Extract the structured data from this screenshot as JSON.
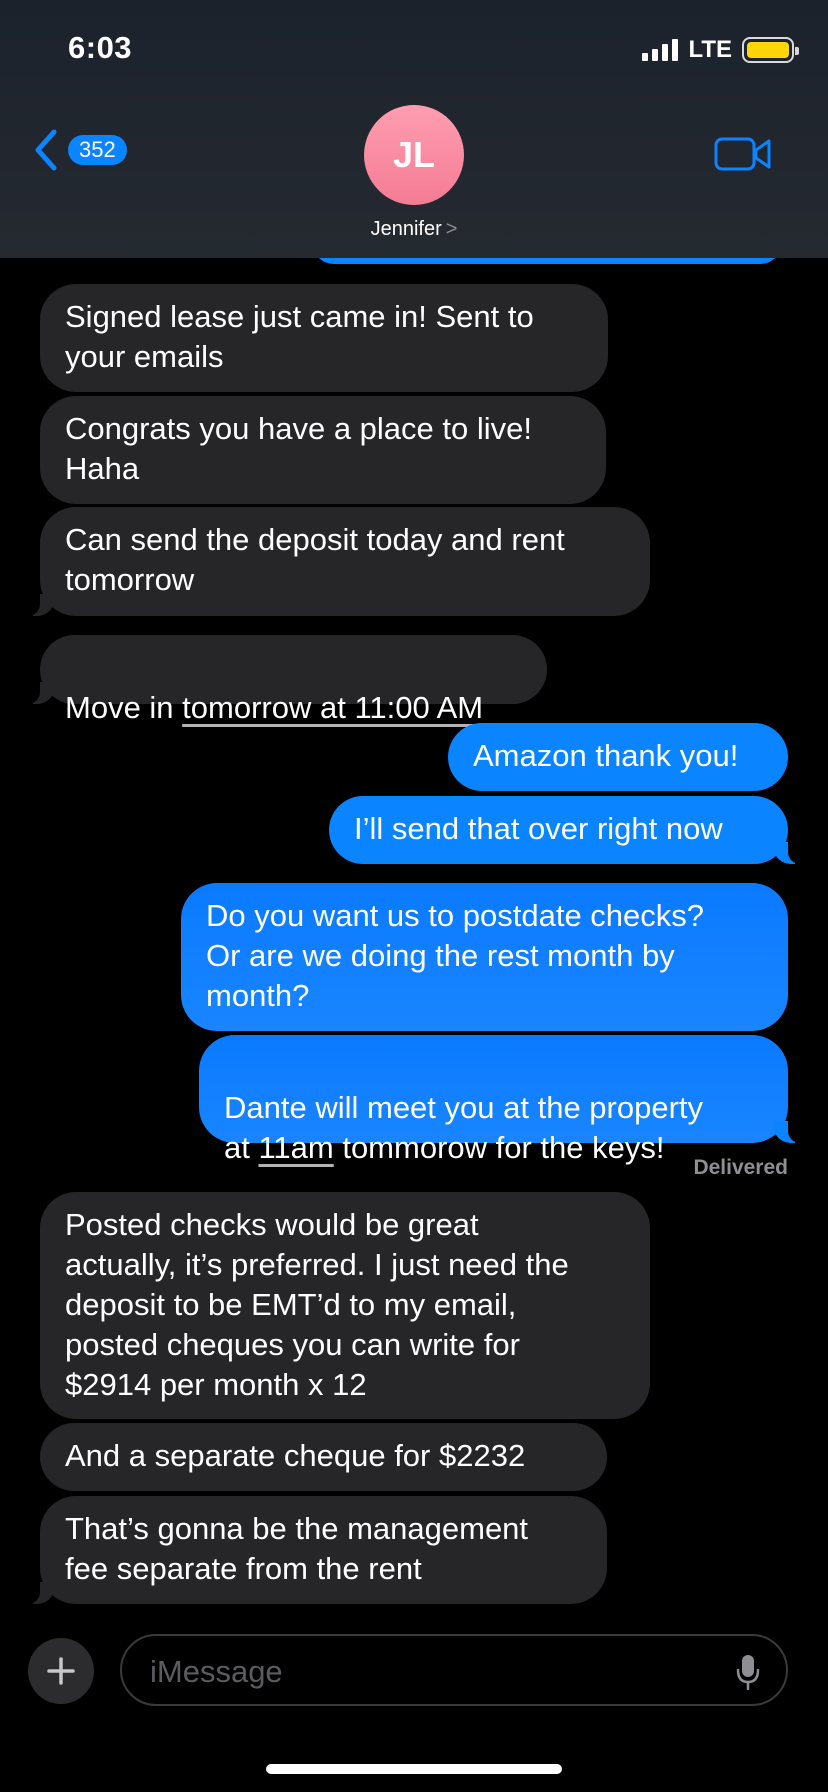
{
  "status_bar": {
    "time": "6:03",
    "network": "LTE",
    "battery_color": "#ffd60a"
  },
  "header": {
    "back_count": "352",
    "avatar_initials": "JL",
    "contact_name": "Jennifer",
    "chevron": ">",
    "back_icon": "chevron-left-icon",
    "video_icon": "video-camera-icon"
  },
  "messages": [
    {
      "direction": "incoming",
      "text": "Signed lease just came in! Sent to\nyour emails"
    },
    {
      "direction": "incoming",
      "text": "Congrats you have a place to live!\nHaha"
    },
    {
      "direction": "incoming",
      "text": "Can send the deposit today and rent\ntomorrow"
    },
    {
      "direction": "incoming",
      "prefix": "Move in ",
      "link": "tomorrow at 11:00 AM"
    },
    {
      "direction": "outgoing",
      "text": "Amazon thank you!"
    },
    {
      "direction": "outgoing",
      "text": "I’ll send that over right now"
    },
    {
      "direction": "outgoing",
      "text": "Do you want us to postdate checks?\nOr are we doing the rest month by\nmonth?"
    },
    {
      "direction": "outgoing",
      "prefix": "Dante will meet you at the property\nat ",
      "link": "11am",
      "suffix": " tommorow for the keys!"
    },
    {
      "direction": "incoming",
      "text": "Posted checks would be great\nactually, it’s preferred. I just need the\ndeposit to be EMT’d to my email,\nposted cheques you can write for\n$2914 per month x 12"
    },
    {
      "direction": "incoming",
      "text": "And a separate cheque for $2232"
    },
    {
      "direction": "incoming",
      "text": "That’s gonna be the management\nfee separate from the rent"
    }
  ],
  "delivered_label": "Delivered",
  "compose": {
    "placeholder": "iMessage",
    "plus_icon": "plus-icon",
    "mic_icon": "microphone-icon"
  },
  "colors": {
    "outgoing_bubble": "#0a84ff",
    "incoming_bubble": "#262628",
    "avatar": "#f47c93"
  }
}
